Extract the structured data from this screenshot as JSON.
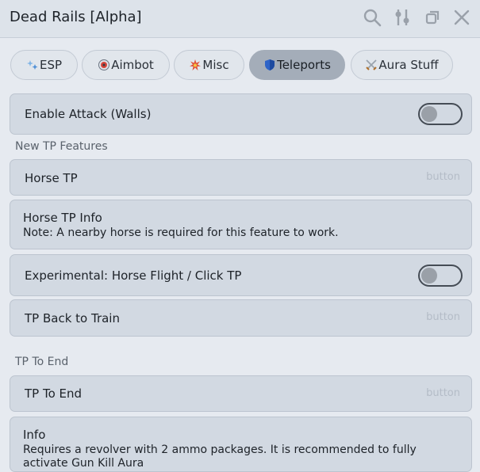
{
  "window": {
    "title": "Dead Rails [Alpha]",
    "controls": [
      "search-icon",
      "settings-sliders-icon",
      "minimize-icon",
      "close-icon"
    ]
  },
  "tabs": [
    {
      "label": "ESP",
      "icon": "sparkle-icon"
    },
    {
      "label": "Aimbot",
      "icon": "target-icon"
    },
    {
      "label": "Misc",
      "icon": "burst-icon"
    },
    {
      "label": "Teleports",
      "icon": "shield-icon",
      "active": true
    },
    {
      "label": "Aura Stuff",
      "icon": "crossed-swords-icon"
    }
  ],
  "content": {
    "enable_attack": {
      "label": "Enable Attack (Walls)",
      "enabled": false
    },
    "section_new_tp": "New TP Features",
    "horse_tp": {
      "label": "Horse TP",
      "hint": "button"
    },
    "horse_tp_info": {
      "title": "Horse TP Info",
      "body": "Note: A nearby horse is required for this feature to work."
    },
    "horse_flight": {
      "label": "Experimental: Horse Flight / Click TP",
      "enabled": false
    },
    "tp_back": {
      "label": "TP Back to Train",
      "hint": "button"
    },
    "section_tp_end": "TP To End",
    "tp_end": {
      "label": "TP To End",
      "hint": "button"
    },
    "info": {
      "title": "Info",
      "body": "Requires a revolver with 2 ammo packages. It is recommended to fully activate Gun Kill Aura"
    }
  },
  "colors": {
    "background": "#e6eaf0",
    "row": "#d2d9e2",
    "active_tab": "#a4adb9",
    "hint_text": "#b4bcc7"
  }
}
